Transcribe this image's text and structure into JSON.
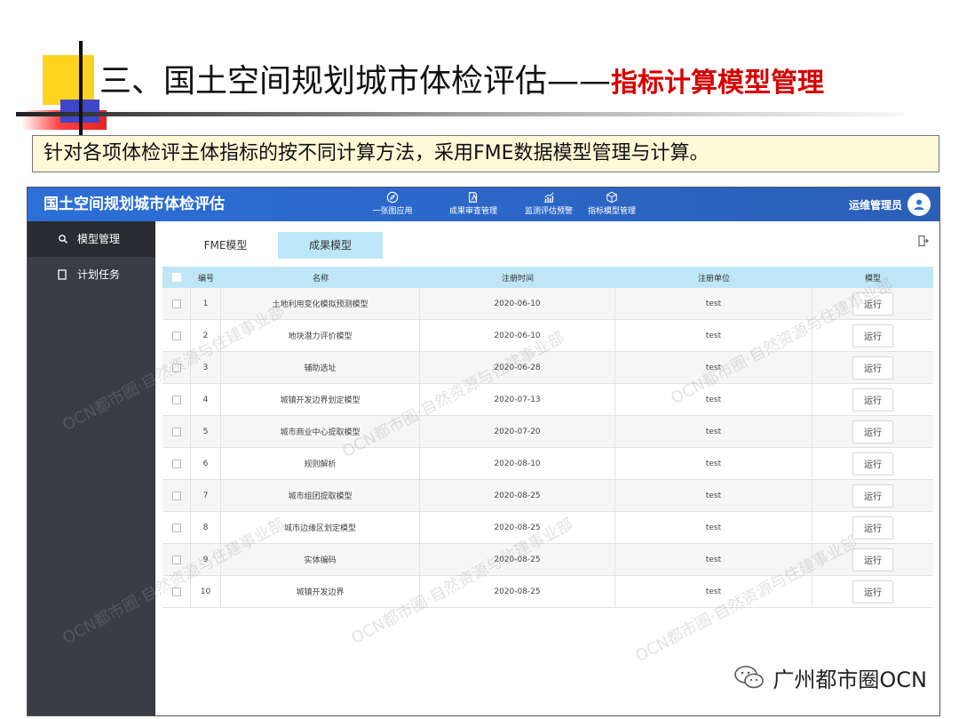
{
  "slide": {
    "title_main": "三、国土空间规划城市体检评估——",
    "title_accent": "指标计算模型管理",
    "subtitle": "针对各项体检评主体指标的按不同计算方法，采用FME数据模型管理与计算。"
  },
  "app": {
    "title": "国土空间规划城市体检评估",
    "nav": [
      {
        "label": "一张图应用",
        "icon": "compass-icon"
      },
      {
        "label": "成果审查管理",
        "icon": "document-edit-icon"
      },
      {
        "label": "监测评估预警",
        "icon": "chart-icon"
      },
      {
        "label": "指标模型管理",
        "icon": "cube-icon"
      }
    ],
    "user_name": "运维管理员",
    "sidebar": [
      {
        "label": "模型管理",
        "icon": "search-icon"
      },
      {
        "label": "计划任务",
        "icon": "square-icon"
      }
    ],
    "tabs": [
      "FME模型",
      "成果模型"
    ],
    "active_tab": "成果模型",
    "table": {
      "headers": {
        "num": "编号",
        "name": "名称",
        "time": "注册时间",
        "unit": "注册单位",
        "model": "模型"
      },
      "run_label": "运行",
      "rows": [
        {
          "num": "1",
          "name": "土地利用变化模拟预测模型",
          "time": "2020-06-10",
          "unit": "test"
        },
        {
          "num": "2",
          "name": "地块潜力评价模型",
          "time": "2020-06-10",
          "unit": "test"
        },
        {
          "num": "3",
          "name": "辅助选址",
          "time": "2020-06-28",
          "unit": "test"
        },
        {
          "num": "4",
          "name": "城镇开发边界划定模型",
          "time": "2020-07-13",
          "unit": "test"
        },
        {
          "num": "5",
          "name": "城市商业中心提取模型",
          "time": "2020-07-20",
          "unit": "test"
        },
        {
          "num": "6",
          "name": "规则解析",
          "time": "2020-08-10",
          "unit": "test"
        },
        {
          "num": "7",
          "name": "城市组团提取模型",
          "time": "2020-08-25",
          "unit": "test"
        },
        {
          "num": "8",
          "name": "城市边缘区划定模型",
          "time": "2020-08-25",
          "unit": "test"
        },
        {
          "num": "9",
          "name": "实体编码",
          "time": "2020-08-25",
          "unit": "test"
        },
        {
          "num": "10",
          "name": "城镇开发边界",
          "time": "2020-08-25",
          "unit": "test"
        }
      ]
    }
  },
  "watermark": "OCN都市圈·自然资源与住建事业部",
  "brand": "广州都市圈OCN",
  "colors": {
    "accent": "#d70000",
    "topbar": "#2c6fd7",
    "sidebar": "#3a3d44",
    "table_header": "#bfe6f6",
    "subtitle_bg": "#fff9d8"
  }
}
